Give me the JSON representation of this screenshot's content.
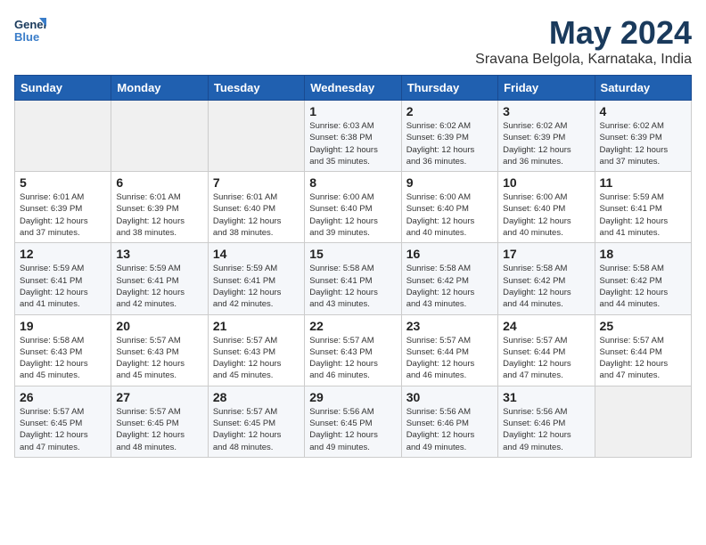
{
  "header": {
    "logo_line1": "General",
    "logo_line2": "Blue",
    "title": "May 2024",
    "subtitle": "Sravana Belgola, Karnataka, India"
  },
  "weekdays": [
    "Sunday",
    "Monday",
    "Tuesday",
    "Wednesday",
    "Thursday",
    "Friday",
    "Saturday"
  ],
  "weeks": [
    [
      {
        "day": "",
        "info": ""
      },
      {
        "day": "",
        "info": ""
      },
      {
        "day": "",
        "info": ""
      },
      {
        "day": "1",
        "info": "Sunrise: 6:03 AM\nSunset: 6:38 PM\nDaylight: 12 hours\nand 35 minutes."
      },
      {
        "day": "2",
        "info": "Sunrise: 6:02 AM\nSunset: 6:39 PM\nDaylight: 12 hours\nand 36 minutes."
      },
      {
        "day": "3",
        "info": "Sunrise: 6:02 AM\nSunset: 6:39 PM\nDaylight: 12 hours\nand 36 minutes."
      },
      {
        "day": "4",
        "info": "Sunrise: 6:02 AM\nSunset: 6:39 PM\nDaylight: 12 hours\nand 37 minutes."
      }
    ],
    [
      {
        "day": "5",
        "info": "Sunrise: 6:01 AM\nSunset: 6:39 PM\nDaylight: 12 hours\nand 37 minutes."
      },
      {
        "day": "6",
        "info": "Sunrise: 6:01 AM\nSunset: 6:39 PM\nDaylight: 12 hours\nand 38 minutes."
      },
      {
        "day": "7",
        "info": "Sunrise: 6:01 AM\nSunset: 6:40 PM\nDaylight: 12 hours\nand 38 minutes."
      },
      {
        "day": "8",
        "info": "Sunrise: 6:00 AM\nSunset: 6:40 PM\nDaylight: 12 hours\nand 39 minutes."
      },
      {
        "day": "9",
        "info": "Sunrise: 6:00 AM\nSunset: 6:40 PM\nDaylight: 12 hours\nand 40 minutes."
      },
      {
        "day": "10",
        "info": "Sunrise: 6:00 AM\nSunset: 6:40 PM\nDaylight: 12 hours\nand 40 minutes."
      },
      {
        "day": "11",
        "info": "Sunrise: 5:59 AM\nSunset: 6:41 PM\nDaylight: 12 hours\nand 41 minutes."
      }
    ],
    [
      {
        "day": "12",
        "info": "Sunrise: 5:59 AM\nSunset: 6:41 PM\nDaylight: 12 hours\nand 41 minutes."
      },
      {
        "day": "13",
        "info": "Sunrise: 5:59 AM\nSunset: 6:41 PM\nDaylight: 12 hours\nand 42 minutes."
      },
      {
        "day": "14",
        "info": "Sunrise: 5:59 AM\nSunset: 6:41 PM\nDaylight: 12 hours\nand 42 minutes."
      },
      {
        "day": "15",
        "info": "Sunrise: 5:58 AM\nSunset: 6:41 PM\nDaylight: 12 hours\nand 43 minutes."
      },
      {
        "day": "16",
        "info": "Sunrise: 5:58 AM\nSunset: 6:42 PM\nDaylight: 12 hours\nand 43 minutes."
      },
      {
        "day": "17",
        "info": "Sunrise: 5:58 AM\nSunset: 6:42 PM\nDaylight: 12 hours\nand 44 minutes."
      },
      {
        "day": "18",
        "info": "Sunrise: 5:58 AM\nSunset: 6:42 PM\nDaylight: 12 hours\nand 44 minutes."
      }
    ],
    [
      {
        "day": "19",
        "info": "Sunrise: 5:58 AM\nSunset: 6:43 PM\nDaylight: 12 hours\nand 45 minutes."
      },
      {
        "day": "20",
        "info": "Sunrise: 5:57 AM\nSunset: 6:43 PM\nDaylight: 12 hours\nand 45 minutes."
      },
      {
        "day": "21",
        "info": "Sunrise: 5:57 AM\nSunset: 6:43 PM\nDaylight: 12 hours\nand 45 minutes."
      },
      {
        "day": "22",
        "info": "Sunrise: 5:57 AM\nSunset: 6:43 PM\nDaylight: 12 hours\nand 46 minutes."
      },
      {
        "day": "23",
        "info": "Sunrise: 5:57 AM\nSunset: 6:44 PM\nDaylight: 12 hours\nand 46 minutes."
      },
      {
        "day": "24",
        "info": "Sunrise: 5:57 AM\nSunset: 6:44 PM\nDaylight: 12 hours\nand 47 minutes."
      },
      {
        "day": "25",
        "info": "Sunrise: 5:57 AM\nSunset: 6:44 PM\nDaylight: 12 hours\nand 47 minutes."
      }
    ],
    [
      {
        "day": "26",
        "info": "Sunrise: 5:57 AM\nSunset: 6:45 PM\nDaylight: 12 hours\nand 47 minutes."
      },
      {
        "day": "27",
        "info": "Sunrise: 5:57 AM\nSunset: 6:45 PM\nDaylight: 12 hours\nand 48 minutes."
      },
      {
        "day": "28",
        "info": "Sunrise: 5:57 AM\nSunset: 6:45 PM\nDaylight: 12 hours\nand 48 minutes."
      },
      {
        "day": "29",
        "info": "Sunrise: 5:56 AM\nSunset: 6:45 PM\nDaylight: 12 hours\nand 49 minutes."
      },
      {
        "day": "30",
        "info": "Sunrise: 5:56 AM\nSunset: 6:46 PM\nDaylight: 12 hours\nand 49 minutes."
      },
      {
        "day": "31",
        "info": "Sunrise: 5:56 AM\nSunset: 6:46 PM\nDaylight: 12 hours\nand 49 minutes."
      },
      {
        "day": "",
        "info": ""
      }
    ]
  ]
}
